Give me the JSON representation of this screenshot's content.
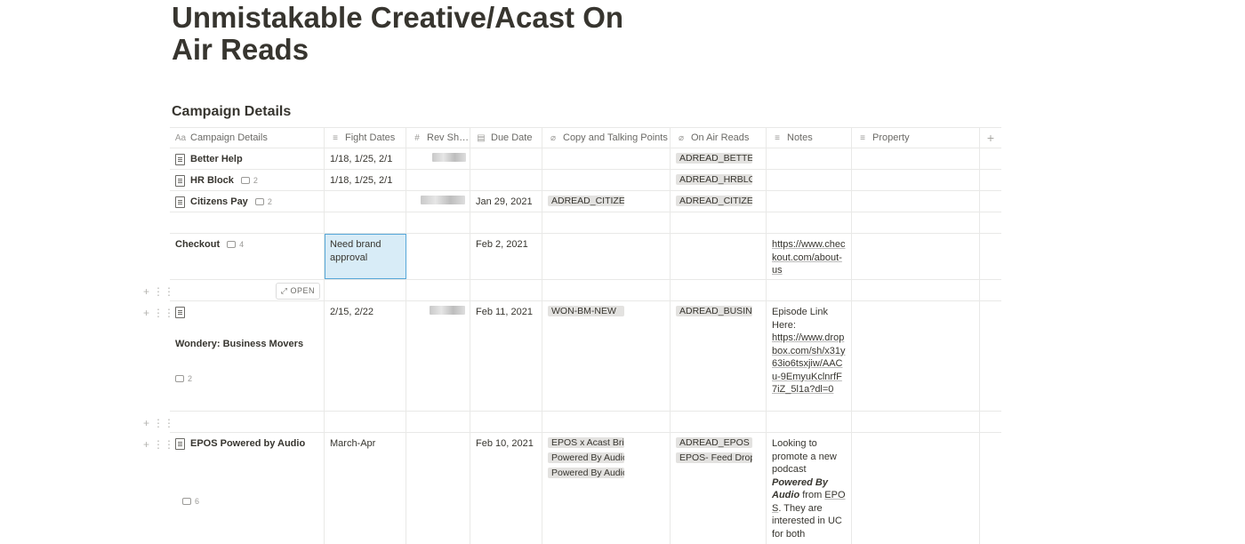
{
  "page": {
    "title": "Unmistakable Creative/Acast On Air Reads"
  },
  "database": {
    "title": "Campaign Details"
  },
  "columns": [
    {
      "label": "Campaign Details",
      "icon": "text-icon"
    },
    {
      "label": "Fight Dates",
      "icon": "text-lines-icon"
    },
    {
      "label": "Rev Sh…",
      "icon": "hash-icon"
    },
    {
      "label": "Due Date",
      "icon": "calendar-icon"
    },
    {
      "label": "Copy and Talking Points",
      "icon": "paperclip-icon"
    },
    {
      "label": "On Air Reads",
      "icon": "paperclip-icon"
    },
    {
      "label": "Notes",
      "icon": "text-lines-icon"
    },
    {
      "label": "Property",
      "icon": "text-lines-icon"
    }
  ],
  "add_column": "+",
  "rows": [
    {
      "name": "Better Help",
      "comments": "",
      "dates": "1/18, 1/25, 2/1",
      "due": "",
      "copy": [],
      "reads": [
        "ADREAD_BETTERHELP"
      ],
      "notes": ""
    },
    {
      "name": "HR Block",
      "comments": "2",
      "dates": "1/18, 1/25, 2/1",
      "due": "",
      "copy": [],
      "reads": [
        "ADREAD_HRBLOCK"
      ],
      "notes": ""
    },
    {
      "name": "Citizens Pay",
      "comments": "2",
      "dates": "",
      "due": "Jan 29, 2021",
      "copy": [
        "ADREAD_CITIZENS"
      ],
      "reads": [
        "ADREAD_CITIZENS"
      ],
      "notes": ""
    },
    {
      "name": "Checkout",
      "comments": "4",
      "dates": "Need brand approval",
      "due": "Feb 2, 2021",
      "notes": "https://www.checkout.com/about-us"
    },
    {
      "name": "Wondery: Business Movers",
      "comments": "2",
      "dates": "2/15, 2/22",
      "due": "Feb 11, 2021",
      "copy": [
        "WON-BM-NEW"
      ],
      "reads": [
        "ADREAD_BUSINESS"
      ],
      "notes_label": "Episode Link Here:",
      "notes_link": "https://www.dropbox.com/sh/x31y63io6tsxjiw/AACu-9EmyuKclnrfF7iZ_5l1a?dl=0"
    },
    {
      "name": "EPOS Powered by Audio",
      "comments": "6",
      "dates": "March-Apr",
      "due": "Feb 10, 2021",
      "copy": [
        "EPOS x Acast Brief",
        "Powered By Audio",
        "Powered By Audio"
      ],
      "reads": [
        "ADREAD_EPOS",
        "EPOS- Feed Drop"
      ],
      "notes_a": "Looking to promote a new podcast ",
      "notes_b": "Powered By Audio",
      "notes_c": " from ",
      "notes_d": "EPOS",
      "notes_e": ". They are interested in UC for both"
    }
  ],
  "open_button": "OPEN"
}
